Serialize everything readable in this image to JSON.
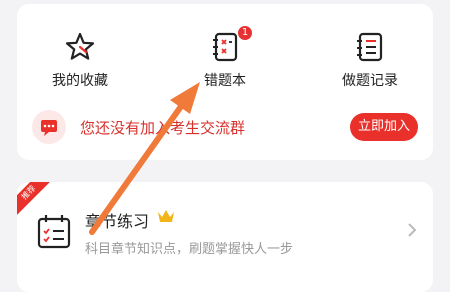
{
  "features": {
    "favorites_label": "我的收藏",
    "wrongbook_label": "错题本",
    "wrongbook_badge": "1",
    "records_label": "做题记录"
  },
  "group_banner": {
    "text": "您还没有加入考生交流群",
    "join_label": "立即加入"
  },
  "chapter": {
    "ribbon": "推荐",
    "title": "章节练习",
    "description": "科目章节知识点，刷题掌握快人一步"
  },
  "colors": {
    "accent": "#e9302a",
    "annotation_arrow": "#f07a3a"
  },
  "icons": [
    "star-icon",
    "notebook-icon",
    "record-icon",
    "message-icon",
    "calendar-checklist-icon",
    "crown-icon",
    "chevron-right-icon"
  ]
}
